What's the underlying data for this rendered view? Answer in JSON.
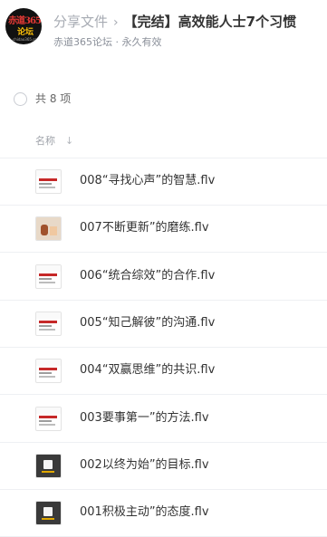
{
  "header": {
    "avatar_text_top": "赤道365",
    "avatar_text_mid": "论坛",
    "avatar_text_small": "chidao365.com",
    "breadcrumb_parent": "分享文件",
    "breadcrumb_sep": "›",
    "title": "【完结】高效能人士7个习惯",
    "subtitle": "赤道365论坛 · 永久有效"
  },
  "list": {
    "count_label": "共 8 项",
    "column_name": "名称",
    "sort_icon": "↓",
    "files": [
      {
        "name": "008“寻找心声”的智慧.flv",
        "thumb": "slide"
      },
      {
        "name": "007不断更新”的磨练.flv",
        "thumb": "photo"
      },
      {
        "name": "006“统合综效”的合作.flv",
        "thumb": "slide"
      },
      {
        "name": "005“知己解彼”的沟通.flv",
        "thumb": "slide"
      },
      {
        "name": "004“双赢思维”的共识.flv",
        "thumb": "slide"
      },
      {
        "name": "003要事第一”的方法.flv",
        "thumb": "slide"
      },
      {
        "name": "002以终为始”的目标.flv",
        "thumb": "dark"
      },
      {
        "name": "001积极主动”的态度.flv",
        "thumb": "dark"
      }
    ]
  }
}
